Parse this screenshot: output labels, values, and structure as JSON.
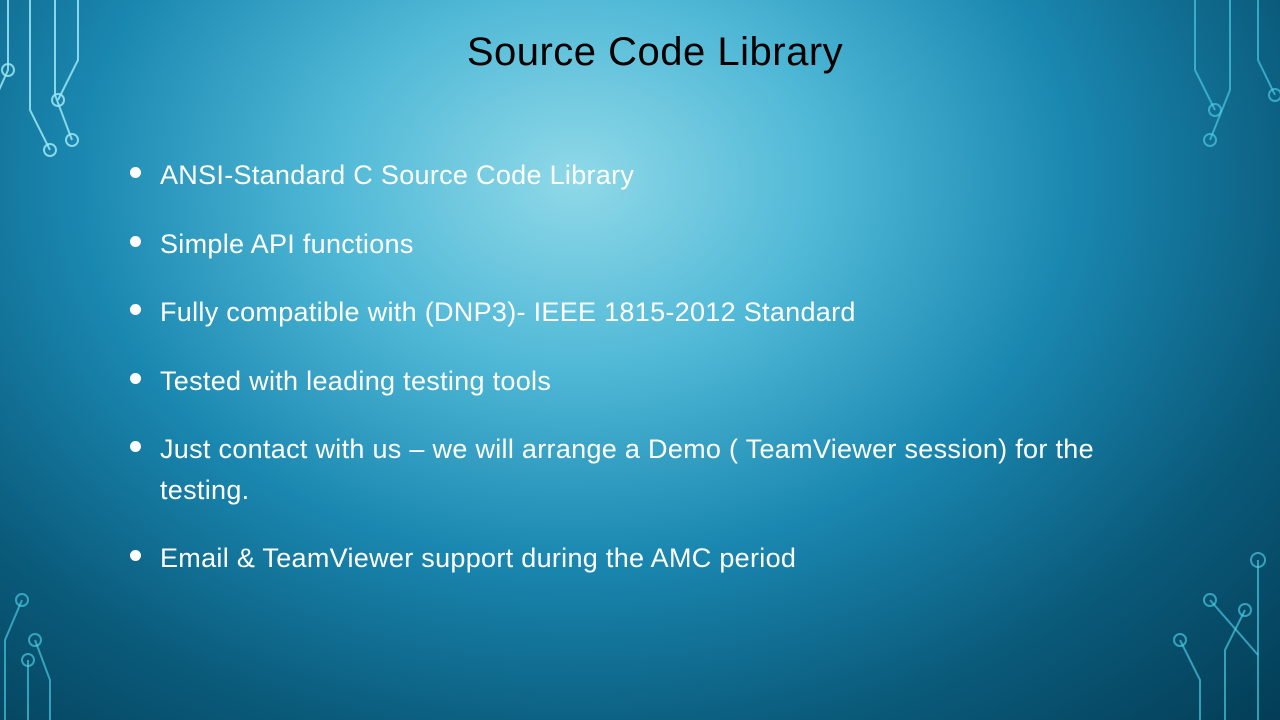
{
  "title": "Source Code Library",
  "bullets": [
    "ANSI-Standard C Source Code Library",
    "Simple API functions",
    "Fully compatible with (DNP3)- IEEE 1815-2012 Standard",
    "Tested with leading testing tools",
    "Just contact with us – we will arrange a Demo ( TeamViewer session) for the testing.",
    "Email & TeamViewer support during the AMC period"
  ]
}
